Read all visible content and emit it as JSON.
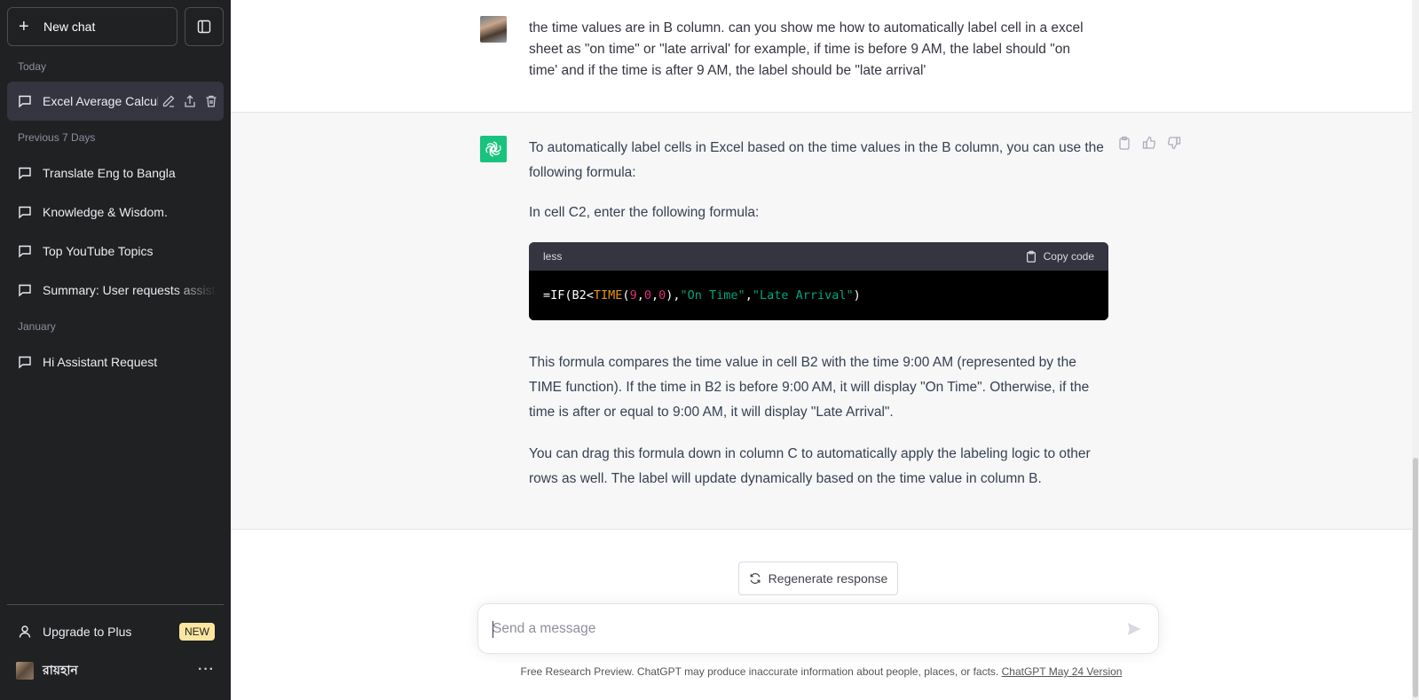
{
  "sidebar": {
    "new_chat_label": "New chat",
    "sections": {
      "today": "Today",
      "previous_7_days": "Previous 7 Days",
      "january": "January"
    },
    "conversations": {
      "active": "Excel Average Calcul",
      "c1": "Translate Eng to Bangla",
      "c2": "Knowledge & Wisdom.",
      "c3": "Top YouTube Topics",
      "c4": "Summary: User requests assist",
      "c5": "Hi Assistant Request"
    },
    "upgrade_label": "Upgrade to Plus",
    "new_badge": "NEW",
    "profile_name": "রায়হান",
    "profile_more": "···"
  },
  "user_message": "the time values are in B column. can you show me how to automatically label cell in a excel sheet as \"on time\" or \"late arrival' for example, if time is before 9 AM, the label should \"on time' and if the time is after 9 AM, the label should be \"late arrival'",
  "assistant_message": {
    "p1": "To automatically label cells in Excel based on the time values in the B column, you can use the following formula:",
    "p2": "In cell C2, enter the following formula:",
    "code": {
      "language": "less",
      "copy_label": "Copy code",
      "tokens": {
        "t1": "=IF(B2<",
        "t2": "TIME",
        "t3": "(",
        "t4": "9",
        "t5": ",",
        "t6": "0",
        "t7": ",",
        "t8": "0",
        "t9": "),",
        "t10": "\"On Time\"",
        "t11": ",",
        "t12": "\"Late Arrival\"",
        "t13": ")"
      }
    },
    "p3": "This formula compares the time value in cell B2 with the time 9:00 AM (represented by the TIME function). If the time in B2 is before 9:00 AM, it will display \"On Time\". Otherwise, if the time is after or equal to 9:00 AM, it will display \"Late Arrival\".",
    "p4": "You can drag this formula down in column C to automatically apply the labeling logic to other rows as well. The label will update dynamically based on the time value in column B."
  },
  "regenerate_label": "Regenerate response",
  "composer": {
    "placeholder": "Send a message",
    "value": ""
  },
  "footer": {
    "text": "Free Research Preview. ChatGPT may produce inaccurate information about people, places, or facts. ",
    "link": "ChatGPT May 24 Version"
  },
  "colors": {
    "sidebar_bg": "#202123",
    "assistant_bg": "#f7f7f8",
    "brand_green": "#19c37d",
    "code_bg": "#000000",
    "badge": "#fae69e"
  }
}
